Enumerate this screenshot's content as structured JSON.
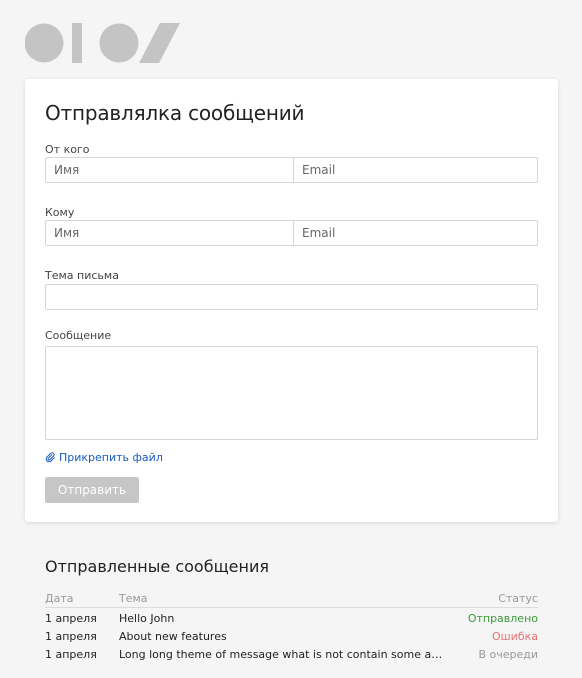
{
  "form": {
    "title": "Отправлялка сообщений",
    "from": {
      "label": "От кого",
      "name_placeholder": "Имя",
      "email_placeholder": "Email"
    },
    "to": {
      "label": "Кому",
      "name_placeholder": "Имя",
      "email_placeholder": "Email"
    },
    "subject": {
      "label": "Тема письма",
      "value": ""
    },
    "message": {
      "label": "Сообщение",
      "value": ""
    },
    "attach_label": "Прикрепить файл",
    "submit_label": "Отправить"
  },
  "sent": {
    "title": "Отправленные сообщения",
    "headers": {
      "date": "Дата",
      "theme": "Тема",
      "status": "Статус"
    },
    "rows": [
      {
        "date": "1 апреля",
        "theme": "Hello John",
        "status": "Отправлено",
        "status_color": "#3a9a3a"
      },
      {
        "date": "1 апреля",
        "theme": "About new features",
        "status": "Ошибка",
        "status_color": "#e57373"
      },
      {
        "date": "1 апреля",
        "theme": "Long long theme of message what is not contain some additional thi...",
        "status": "В очереди",
        "status_color": "#999999"
      }
    ]
  },
  "colors": {
    "logo": "#c4c4c4",
    "link": "#1a5bbf",
    "button_disabled": "#c6c6c6"
  }
}
